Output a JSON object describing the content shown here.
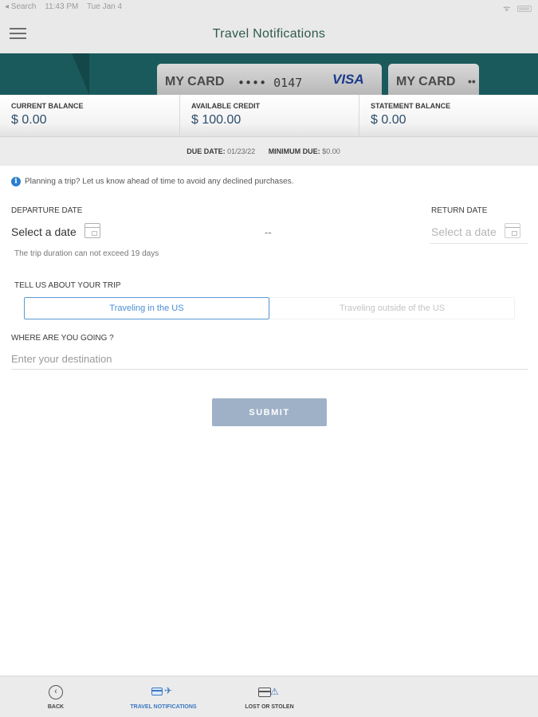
{
  "status_bar": {
    "back_label": "◂ Search",
    "time": "11:43 PM",
    "date": "Tue Jan 4",
    "wifi_glyph": "ᯤ"
  },
  "nav": {
    "title": "Travel Notifications",
    "menu_icon": "hamburger-menu-icon"
  },
  "cards": [
    {
      "label": "MY CARD",
      "digits": "•••• 0147",
      "brand": "VISA"
    },
    {
      "label": "MY CARD",
      "digits": "••"
    }
  ],
  "balances": [
    {
      "title": "CURRENT BALANCE",
      "value": "$ 0.00"
    },
    {
      "title": "AVAILABLE CREDIT",
      "value": "$ 100.00"
    },
    {
      "title": "STATEMENT BALANCE",
      "value": "$ 0.00"
    }
  ],
  "due": {
    "due_label": "DUE DATE:",
    "due_value": "01/23/22",
    "min_label": "MINIMUM DUE:",
    "min_value": "$0.00"
  },
  "form": {
    "info_icon_glyph": "i",
    "info_text": "Planning a trip? Let us know ahead of time to avoid any declined purchases.",
    "departure_label": "DEPARTURE DATE",
    "departure_placeholder": "Select a date",
    "return_label": "RETURN DATE",
    "return_placeholder": "Select a date",
    "date_separator": "--",
    "duration_note": "The trip duration can not exceed 19 days",
    "trip_label": "TELL US ABOUT YOUR TRIP",
    "trip_options": [
      "Traveling in the US",
      "Traveling outside of the US"
    ],
    "trip_selected": "Traveling in the US",
    "destination_label": "WHERE ARE YOU GOING ?",
    "destination_placeholder": "Enter your destination",
    "submit_label": "SUBMIT"
  },
  "tabs": [
    {
      "label": "BACK",
      "icon": "back-circle-icon",
      "active": false
    },
    {
      "label": "TRAVEL NOTIFICATIONS",
      "icon": "travel-card-icon",
      "active": true
    },
    {
      "label": "LOST OR STOLEN",
      "icon": "lost-card-warning-icon",
      "active": false
    }
  ],
  "colors": {
    "brand_teal": "#1b5a5c",
    "title_green": "#2f5a4d",
    "accent_blue": "#3a78c2",
    "submit_disabled": "#9fb1c6"
  }
}
